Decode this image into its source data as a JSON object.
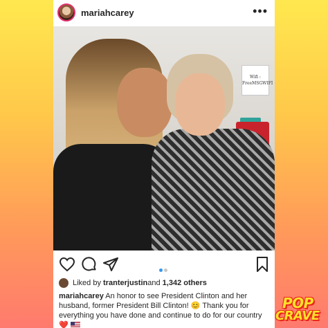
{
  "post": {
    "username": "mariahcarey",
    "more_label": "•••"
  },
  "photo": {
    "sign_text_1": "Wifi :",
    "sign_text_2": "FreeMSGWIFI"
  },
  "actions": {
    "icons": [
      "heart-icon",
      "comment-icon",
      "share-icon",
      "bookmark-icon"
    ],
    "carousel_active_index": 1,
    "carousel_count": 2
  },
  "likes": {
    "prefix": "Liked by ",
    "user": "tranterjustin",
    "middle": " and ",
    "count": "1,342 others"
  },
  "caption": {
    "username": "mariahcarey",
    "text": " An honor to see President Clinton and her husband, former President Bill Clinton! 😊 Thank you for everything you have done and continue to do for our country ❤️ "
  },
  "brand": {
    "line1": "POP",
    "line2": "CRAVE"
  },
  "colors": {
    "accent_blue": "#3897f0",
    "text": "#262626",
    "logo_yellow": "#ffe12b",
    "logo_red": "#e8291c"
  }
}
